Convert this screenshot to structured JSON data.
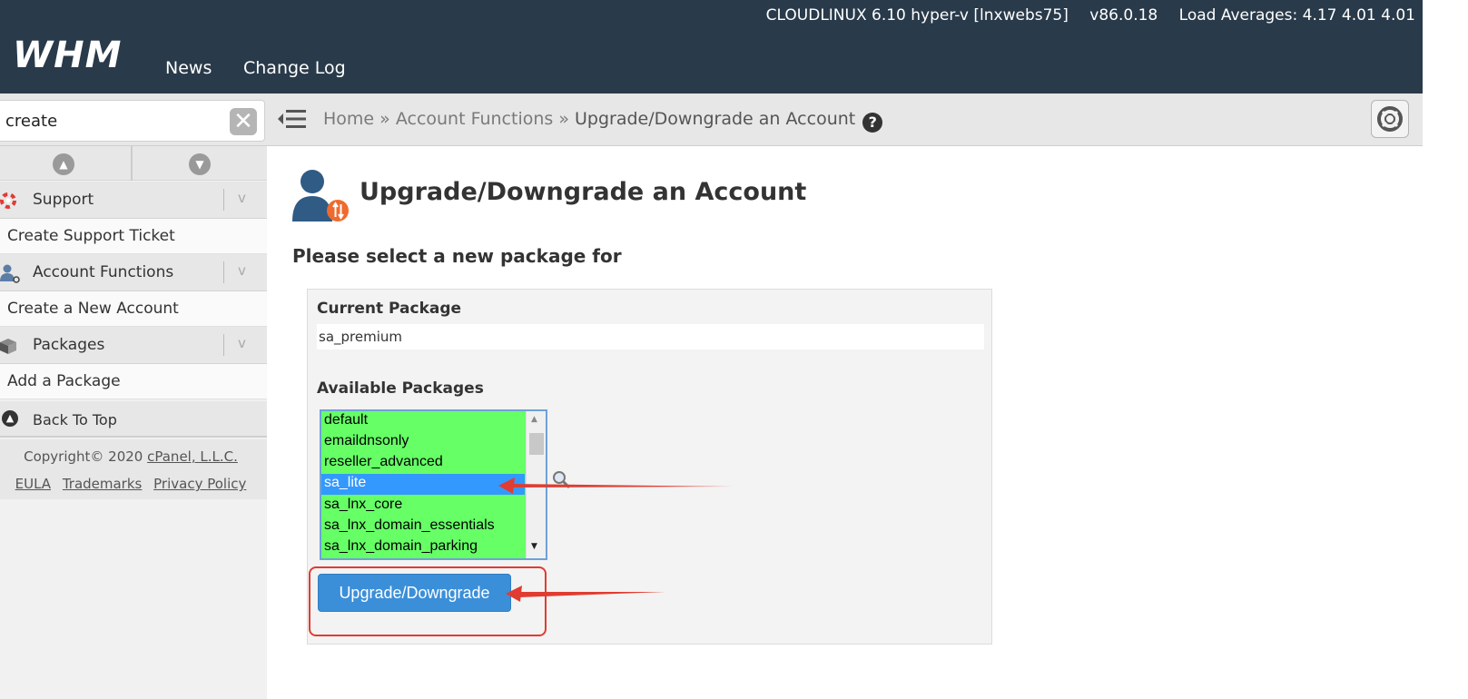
{
  "header": {
    "logo": "WHM",
    "server_info": "CLOUDLINUX 6.10 hyper-v [lnxwebs75]",
    "version": "v86.0.18",
    "load_averages": "Load Averages: 4.17 4.01 4.01",
    "nav": [
      {
        "label": "News"
      },
      {
        "label": "Change Log"
      }
    ]
  },
  "search": {
    "value": "create",
    "clear_glyph": "✕"
  },
  "breadcrumb": {
    "home": "Home",
    "sep1": " » ",
    "section": "Account Functions",
    "sep2": " » ",
    "current": "Upgrade/Downgrade an Account",
    "help_glyph": "?"
  },
  "sidebar": {
    "categories": [
      {
        "label": "Support",
        "chevron": "v",
        "icon": "lifebuoy-icon",
        "sub": "Create Support Ticket"
      },
      {
        "label": "Account Functions",
        "chevron": "v",
        "icon": "user-icon",
        "sub": "Create a New Account"
      },
      {
        "label": "Packages",
        "chevron": "v",
        "icon": "package-icon",
        "sub": "Add a Package"
      }
    ],
    "back_to_top": "Back To Top",
    "footer": {
      "copyright": "Copyright© 2020 ",
      "company": "cPanel, L.L.C.",
      "links": [
        "EULA",
        "Trademarks",
        "Privacy Policy"
      ]
    }
  },
  "main": {
    "title": "Upgrade/Downgrade an Account",
    "subtitle": "Please select a new package for",
    "current_package_label": "Current Package",
    "current_package_value": "sa_premium",
    "available_packages_label": "Available Packages",
    "packages": [
      "default",
      "emaildnsonly",
      "reseller_advanced",
      "sa_lite",
      "sa_lnx_core",
      "sa_lnx_domain_essentials",
      "sa_lnx_domain_parking"
    ],
    "selected_package": "sa_lite",
    "submit_label": "Upgrade/Downgrade"
  },
  "colors": {
    "header_bg": "#293a4a",
    "list_bg": "#66ff66",
    "selected_bg": "#3399ff",
    "button_bg": "#3b8fd9",
    "annotation": "#e03c31"
  }
}
